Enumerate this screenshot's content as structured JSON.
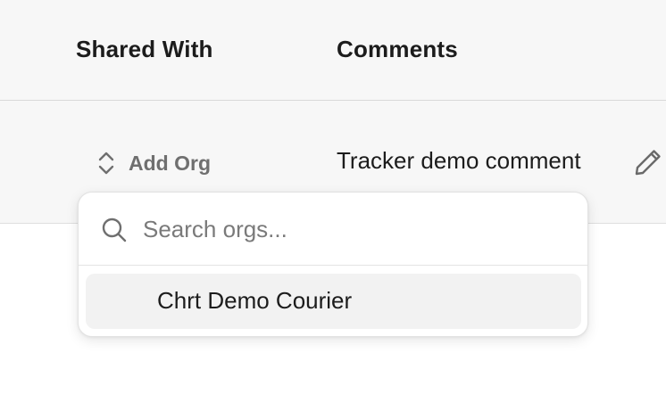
{
  "table": {
    "headers": {
      "shared_with": "Shared With",
      "comments": "Comments"
    },
    "row": {
      "add_org_label": "Add Org",
      "comment": "Tracker demo comment"
    }
  },
  "org_picker": {
    "search_placeholder": "Search orgs...",
    "options": [
      {
        "label": "Chrt Demo Courier"
      }
    ]
  },
  "icons": {
    "add_org": "chevrons-up-down-icon",
    "edit": "pencil-icon",
    "search": "search-icon"
  },
  "colors": {
    "header_bg": "#f7f7f7",
    "muted_text": "#6f6f6f",
    "option_highlight": "#f2f2f2"
  }
}
